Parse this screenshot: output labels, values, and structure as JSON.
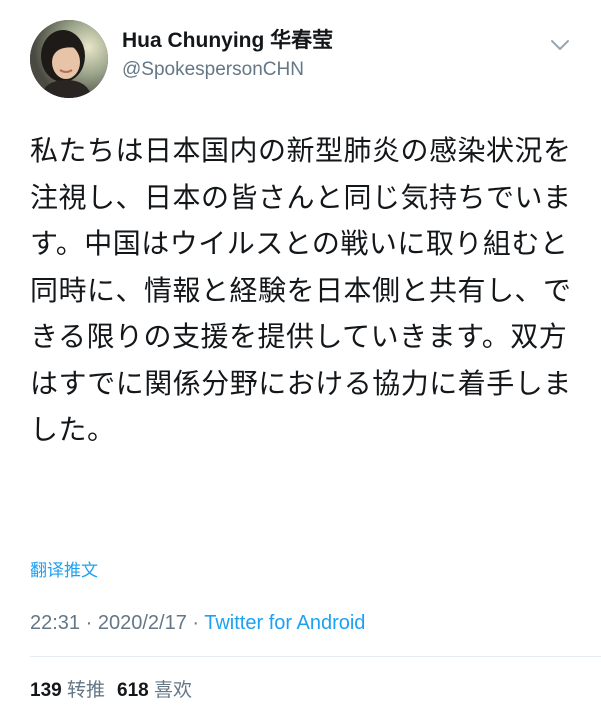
{
  "user": {
    "display_name": "Hua Chunying 华春莹",
    "handle": "@SpokespersonCHN"
  },
  "icons": {
    "avatar": "profile-photo",
    "menu": "chevron-down-icon"
  },
  "tweet": {
    "text": "私たちは日本国内の新型肺炎の感染状況を注視し、日本の皆さんと同じ気持ちでいます。中国はウイルスとの戦いに取り組むと同時に、情報と経験を日本側と共有し、できる限りの支援を提供していきます。双方はすでに関係分野における協力に着手しました。",
    "translate_label": "翻译推文",
    "time": "22:31",
    "separator_1": " · ",
    "date": "2020/2/17",
    "separator_2": " · ",
    "source": "Twitter for Android"
  },
  "stats": {
    "retweets_count": "139",
    "retweets_label": "转推",
    "likes_count": "618",
    "likes_label": "喜欢"
  },
  "colors": {
    "link": "#1da1f2",
    "secondary": "#657786",
    "primary_text": "#14171a"
  }
}
